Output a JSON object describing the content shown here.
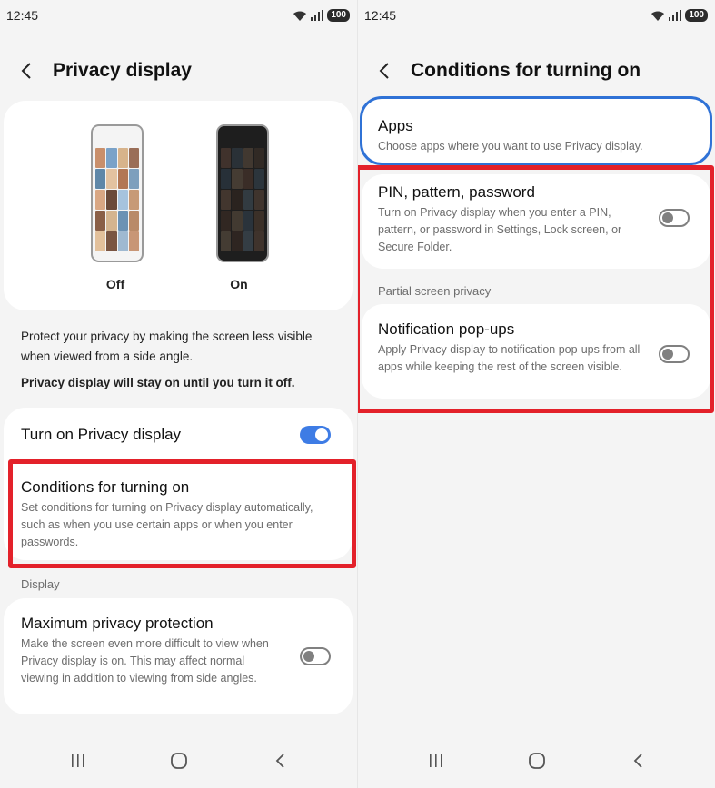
{
  "status": {
    "time": "12:45",
    "battery": "100"
  },
  "left": {
    "title": "Privacy display",
    "preview": {
      "off_label": "Off",
      "on_label": "On"
    },
    "intro": "Protect your privacy by making the screen less visible when viewed from a side angle.",
    "intro_bold": "Privacy display will stay on until you turn it off.",
    "turn_on": {
      "title": "Turn on Privacy display",
      "enabled": true
    },
    "conditions": {
      "title": "Conditions for turning on",
      "desc": "Set conditions for turning on Privacy display automatically, such as when you use certain apps or when you enter passwords."
    },
    "display_section": "Display",
    "max_privacy": {
      "title": "Maximum privacy protection",
      "desc": "Make the screen even more difficult to view when Privacy display is on. This may affect normal viewing in addition to viewing from side angles.",
      "enabled": false
    }
  },
  "right": {
    "title": "Conditions for turning on",
    "apps": {
      "title": "Apps",
      "desc": "Choose apps where you want to use Privacy display."
    },
    "pin": {
      "title": "PIN, pattern, password",
      "desc": "Turn on Privacy display when you enter a PIN, pattern, or password in Settings, Lock screen, or Secure Folder.",
      "enabled": false
    },
    "partial_section": "Partial screen privacy",
    "notifications": {
      "title": "Notification pop-ups",
      "desc": "Apply Privacy display to notification pop-ups from all apps while keeping the rest of the screen visible.",
      "enabled": false
    }
  },
  "colors": {
    "accent": "#3e7ce5",
    "highlight": "#e3212a",
    "apps_border": "#2f72d6"
  },
  "icons": [
    "wifi-icon",
    "signal-icon",
    "battery-icon",
    "back-arrow-icon",
    "recents-icon",
    "home-icon",
    "nav-back-icon"
  ]
}
